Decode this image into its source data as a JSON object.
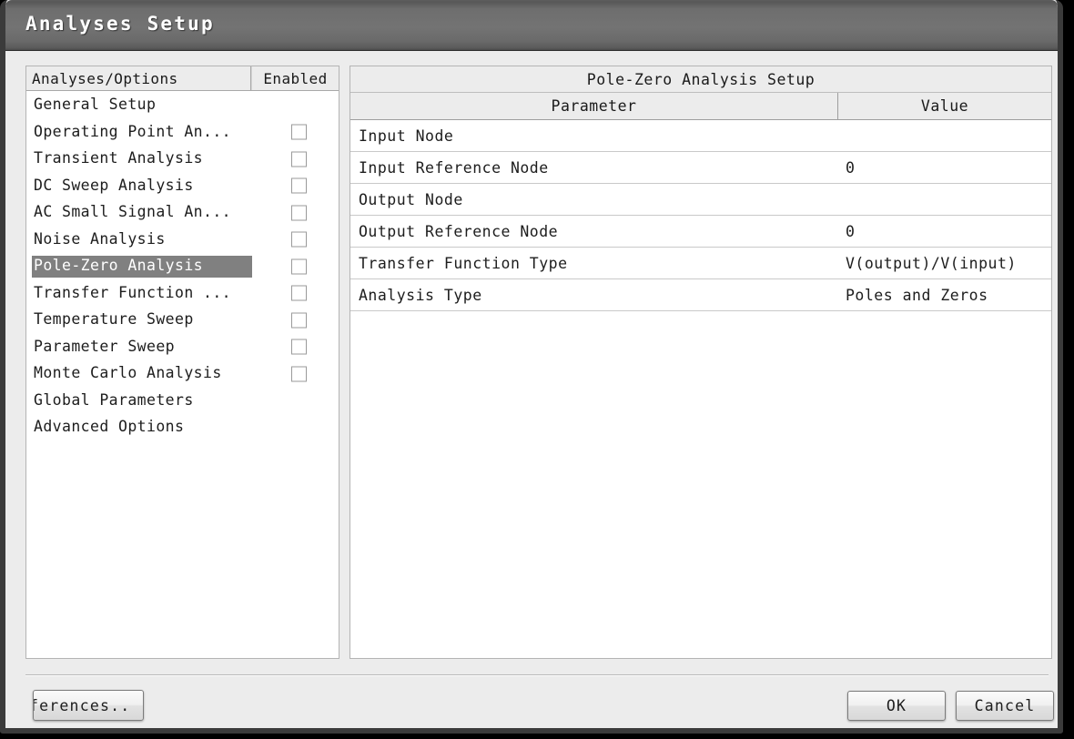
{
  "window": {
    "title": "Analyses Setup"
  },
  "left_panel": {
    "headers": {
      "name": "Analyses/Options",
      "enabled": "Enabled"
    },
    "items": [
      {
        "label": "General Setup",
        "has_checkbox": false,
        "checked": false,
        "selected": false
      },
      {
        "label": "Operating Point An...",
        "has_checkbox": true,
        "checked": false,
        "selected": false
      },
      {
        "label": "Transient Analysis",
        "has_checkbox": true,
        "checked": false,
        "selected": false
      },
      {
        "label": "DC Sweep Analysis",
        "has_checkbox": true,
        "checked": false,
        "selected": false
      },
      {
        "label": "AC Small Signal An...",
        "has_checkbox": true,
        "checked": false,
        "selected": false
      },
      {
        "label": "Noise Analysis",
        "has_checkbox": true,
        "checked": false,
        "selected": false
      },
      {
        "label": "Pole-Zero Analysis",
        "has_checkbox": true,
        "checked": false,
        "selected": true
      },
      {
        "label": "Transfer Function ...",
        "has_checkbox": true,
        "checked": false,
        "selected": false
      },
      {
        "label": "Temperature Sweep",
        "has_checkbox": true,
        "checked": false,
        "selected": false
      },
      {
        "label": "Parameter Sweep",
        "has_checkbox": true,
        "checked": false,
        "selected": false
      },
      {
        "label": "Monte Carlo Analysis",
        "has_checkbox": true,
        "checked": false,
        "selected": false
      },
      {
        "label": "Global Parameters",
        "has_checkbox": false,
        "checked": false,
        "selected": false
      },
      {
        "label": "Advanced Options",
        "has_checkbox": false,
        "checked": false,
        "selected": false
      }
    ]
  },
  "right_panel": {
    "title": "Pole-Zero Analysis Setup",
    "headers": {
      "parameter": "Parameter",
      "value": "Value"
    },
    "rows": [
      {
        "parameter": "Input Node",
        "value": ""
      },
      {
        "parameter": "Input Reference Node",
        "value": "0"
      },
      {
        "parameter": "Output Node",
        "value": ""
      },
      {
        "parameter": "Output Reference Node",
        "value": "0"
      },
      {
        "parameter": "Transfer Function Type",
        "value": "V(output)/V(input)"
      },
      {
        "parameter": "Analysis Type",
        "value": "Poles and Zeros"
      }
    ]
  },
  "footer": {
    "preferences_label": "Preferences..",
    "ok_label": "OK",
    "cancel_label": "Cancel"
  },
  "colors": {
    "titlebar": "#6e6e6e",
    "window_bg": "#ececec",
    "panel_bg": "#ffffff",
    "selection": "#808080",
    "frame": "#3b3b3b"
  }
}
